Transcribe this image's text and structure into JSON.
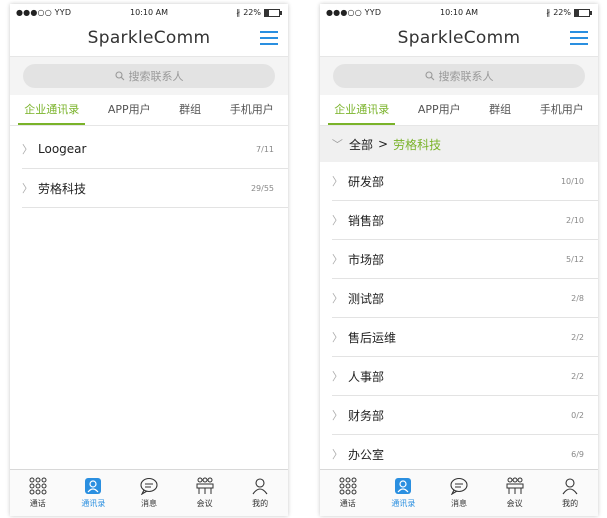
{
  "status": {
    "signal": "●●●○○ YYD",
    "time": "10:10 AM",
    "battery": "22%"
  },
  "app_title": "SparkleComm",
  "search": {
    "placeholder": "搜索联系人"
  },
  "tabs": [
    "企业通讯录",
    "APP用户",
    "群组",
    "手机用户"
  ],
  "screen1": {
    "rows": [
      {
        "name": "Loogear",
        "count": "7/11"
      },
      {
        "name": "劳格科技",
        "count": "29/55"
      }
    ]
  },
  "screen2": {
    "breadcrumb": {
      "root": "全部",
      "separator": ">",
      "current": "劳格科技"
    },
    "rows": [
      {
        "name": "研发部",
        "count": "10/10"
      },
      {
        "name": "销售部",
        "count": "2/10"
      },
      {
        "name": "市场部",
        "count": "5/12"
      },
      {
        "name": "测试部",
        "count": "2/8"
      },
      {
        "name": "售后运维",
        "count": "2/2"
      },
      {
        "name": "人事部",
        "count": "2/2"
      },
      {
        "name": "财务部",
        "count": "0/2"
      },
      {
        "name": "办公室",
        "count": "6/9"
      }
    ]
  },
  "tabbar": [
    {
      "label": "通话",
      "icon": "dialpad-icon"
    },
    {
      "label": "通讯录",
      "icon": "contacts-icon"
    },
    {
      "label": "消息",
      "icon": "chat-bubble-icon"
    },
    {
      "label": "会议",
      "icon": "meeting-icon"
    },
    {
      "label": "我的",
      "icon": "person-icon"
    }
  ],
  "colors": {
    "accent_green": "#7ab32a",
    "accent_blue": "#2a8fe0"
  }
}
